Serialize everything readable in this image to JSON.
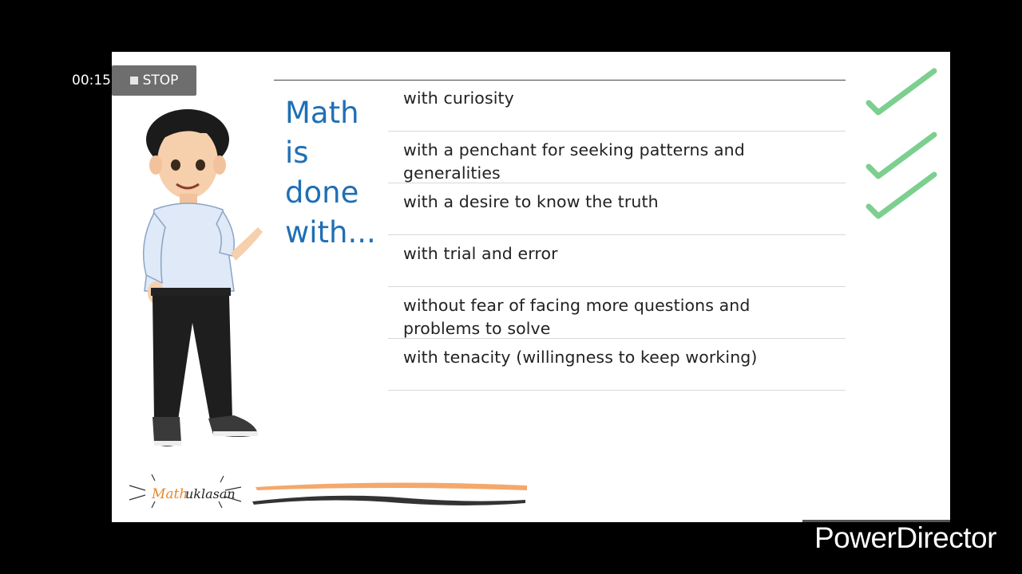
{
  "recorder": {
    "time": "00:15",
    "stop_label": "STOP"
  },
  "slide": {
    "title_lines": [
      "Math",
      "is",
      "done",
      "with..."
    ],
    "items": [
      "with curiosity",
      "with a penchant for seeking patterns and generalities",
      "with a desire to know the truth",
      "with trial and error",
      "without  fear of facing more questions and problems to solve",
      "with tenacity (willingness to keep working)"
    ],
    "logo_text": "Mathuklasan",
    "check_color": "#7ccf8f"
  },
  "watermark": "PowerDirector"
}
